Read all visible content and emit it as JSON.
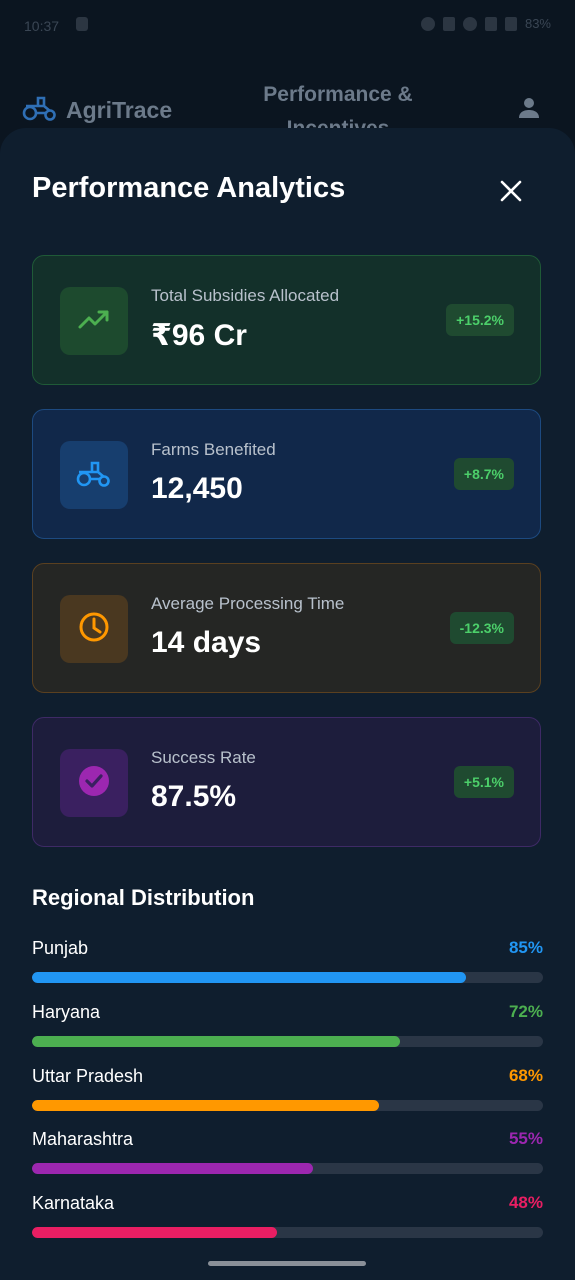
{
  "status_bar": {
    "time": "10:37",
    "battery": "83%"
  },
  "app_header": {
    "brand": "AgriTrace",
    "title": "Performance & Incentives",
    "icons": {
      "brand": "tractor-icon",
      "profile": "person-icon"
    }
  },
  "sheet": {
    "title": "Performance Analytics",
    "close_icon": "close-icon",
    "cards": [
      {
        "label": "Total Subsidies Allocated",
        "value": "₹96 Cr",
        "change": "+15.2%",
        "icon": "trending-up-icon",
        "accent": "#4caf50"
      },
      {
        "label": "Farms Benefited",
        "value": "12,450",
        "change": "+8.7%",
        "icon": "tractor-icon",
        "accent": "#2196f3"
      },
      {
        "label": "Average Processing Time",
        "value": "14 days",
        "change": "-12.3%",
        "icon": "clock-icon",
        "accent": "#ff9800"
      },
      {
        "label": "Success Rate",
        "value": "87.5%",
        "change": "+5.1%",
        "icon": "check-circle-icon",
        "accent": "#9c27b0"
      }
    ],
    "regional": {
      "title": "Regional Distribution",
      "regions": [
        {
          "name": "Punjab",
          "percent_label": "85%",
          "value": 85,
          "color": "#2196f3"
        },
        {
          "name": "Haryana",
          "percent_label": "72%",
          "value": 72,
          "color": "#4caf50"
        },
        {
          "name": "Uttar Pradesh",
          "percent_label": "68%",
          "value": 68,
          "color": "#ff9800"
        },
        {
          "name": "Maharashtra",
          "percent_label": "55%",
          "value": 55,
          "color": "#9c27b0"
        },
        {
          "name": "Karnataka",
          "percent_label": "48%",
          "value": 48,
          "color": "#e91e63"
        }
      ]
    }
  }
}
